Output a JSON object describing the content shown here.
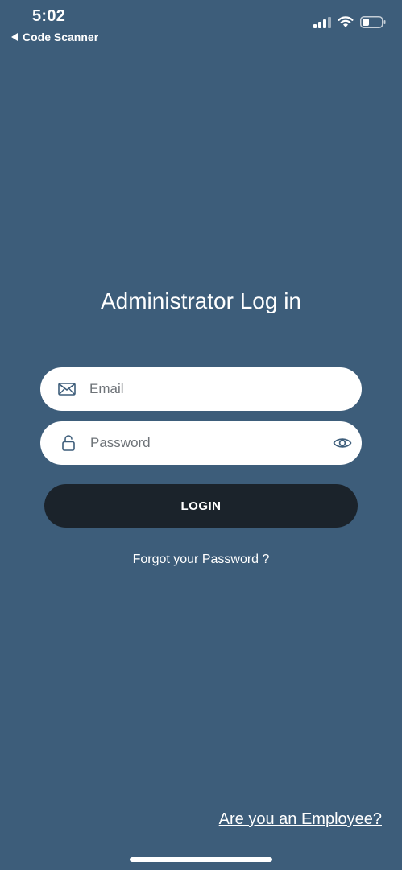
{
  "status_bar": {
    "time": "5:02",
    "back_label": "Code Scanner",
    "icons": [
      "cellular-signal-icon",
      "wifi-icon",
      "battery-icon"
    ]
  },
  "login": {
    "title": "Administrator Log in",
    "email_placeholder": "Email",
    "password_placeholder": "Password",
    "login_label": "LOGIN",
    "forgot_label": "Forgot your Password ?",
    "employee_label": "Are you an Employee?"
  },
  "colors": {
    "background": "#3d5d7a",
    "button": "#1b232b",
    "field": "#ffffff",
    "text": "#ffffff",
    "icon": "#3d5d7a"
  }
}
